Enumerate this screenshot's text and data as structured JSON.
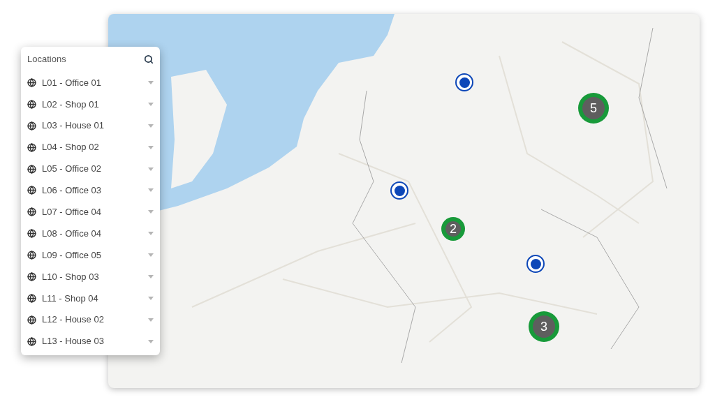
{
  "panel": {
    "title": "Locations",
    "items": [
      {
        "label": "L01 - Office 01"
      },
      {
        "label": "L02 - Shop 01"
      },
      {
        "label": "L03 - House 01"
      },
      {
        "label": "L04 - Shop 02"
      },
      {
        "label": "L05 - Office 02"
      },
      {
        "label": "L06 - Office 03"
      },
      {
        "label": "L07 - Office 04"
      },
      {
        "label": "L08 - Office 04"
      },
      {
        "label": "L09 - Office 05"
      },
      {
        "label": "L10 - Shop 03"
      },
      {
        "label": "L11 - Shop 04"
      },
      {
        "label": "L12 - House 02"
      },
      {
        "label": "L13 - House 03"
      }
    ]
  },
  "map": {
    "markers": [
      {
        "kind": "pin"
      },
      {
        "kind": "pin"
      },
      {
        "kind": "pin"
      },
      {
        "kind": "cluster",
        "count": "5"
      },
      {
        "kind": "cluster",
        "count": "2"
      },
      {
        "kind": "cluster",
        "count": "3"
      }
    ]
  }
}
